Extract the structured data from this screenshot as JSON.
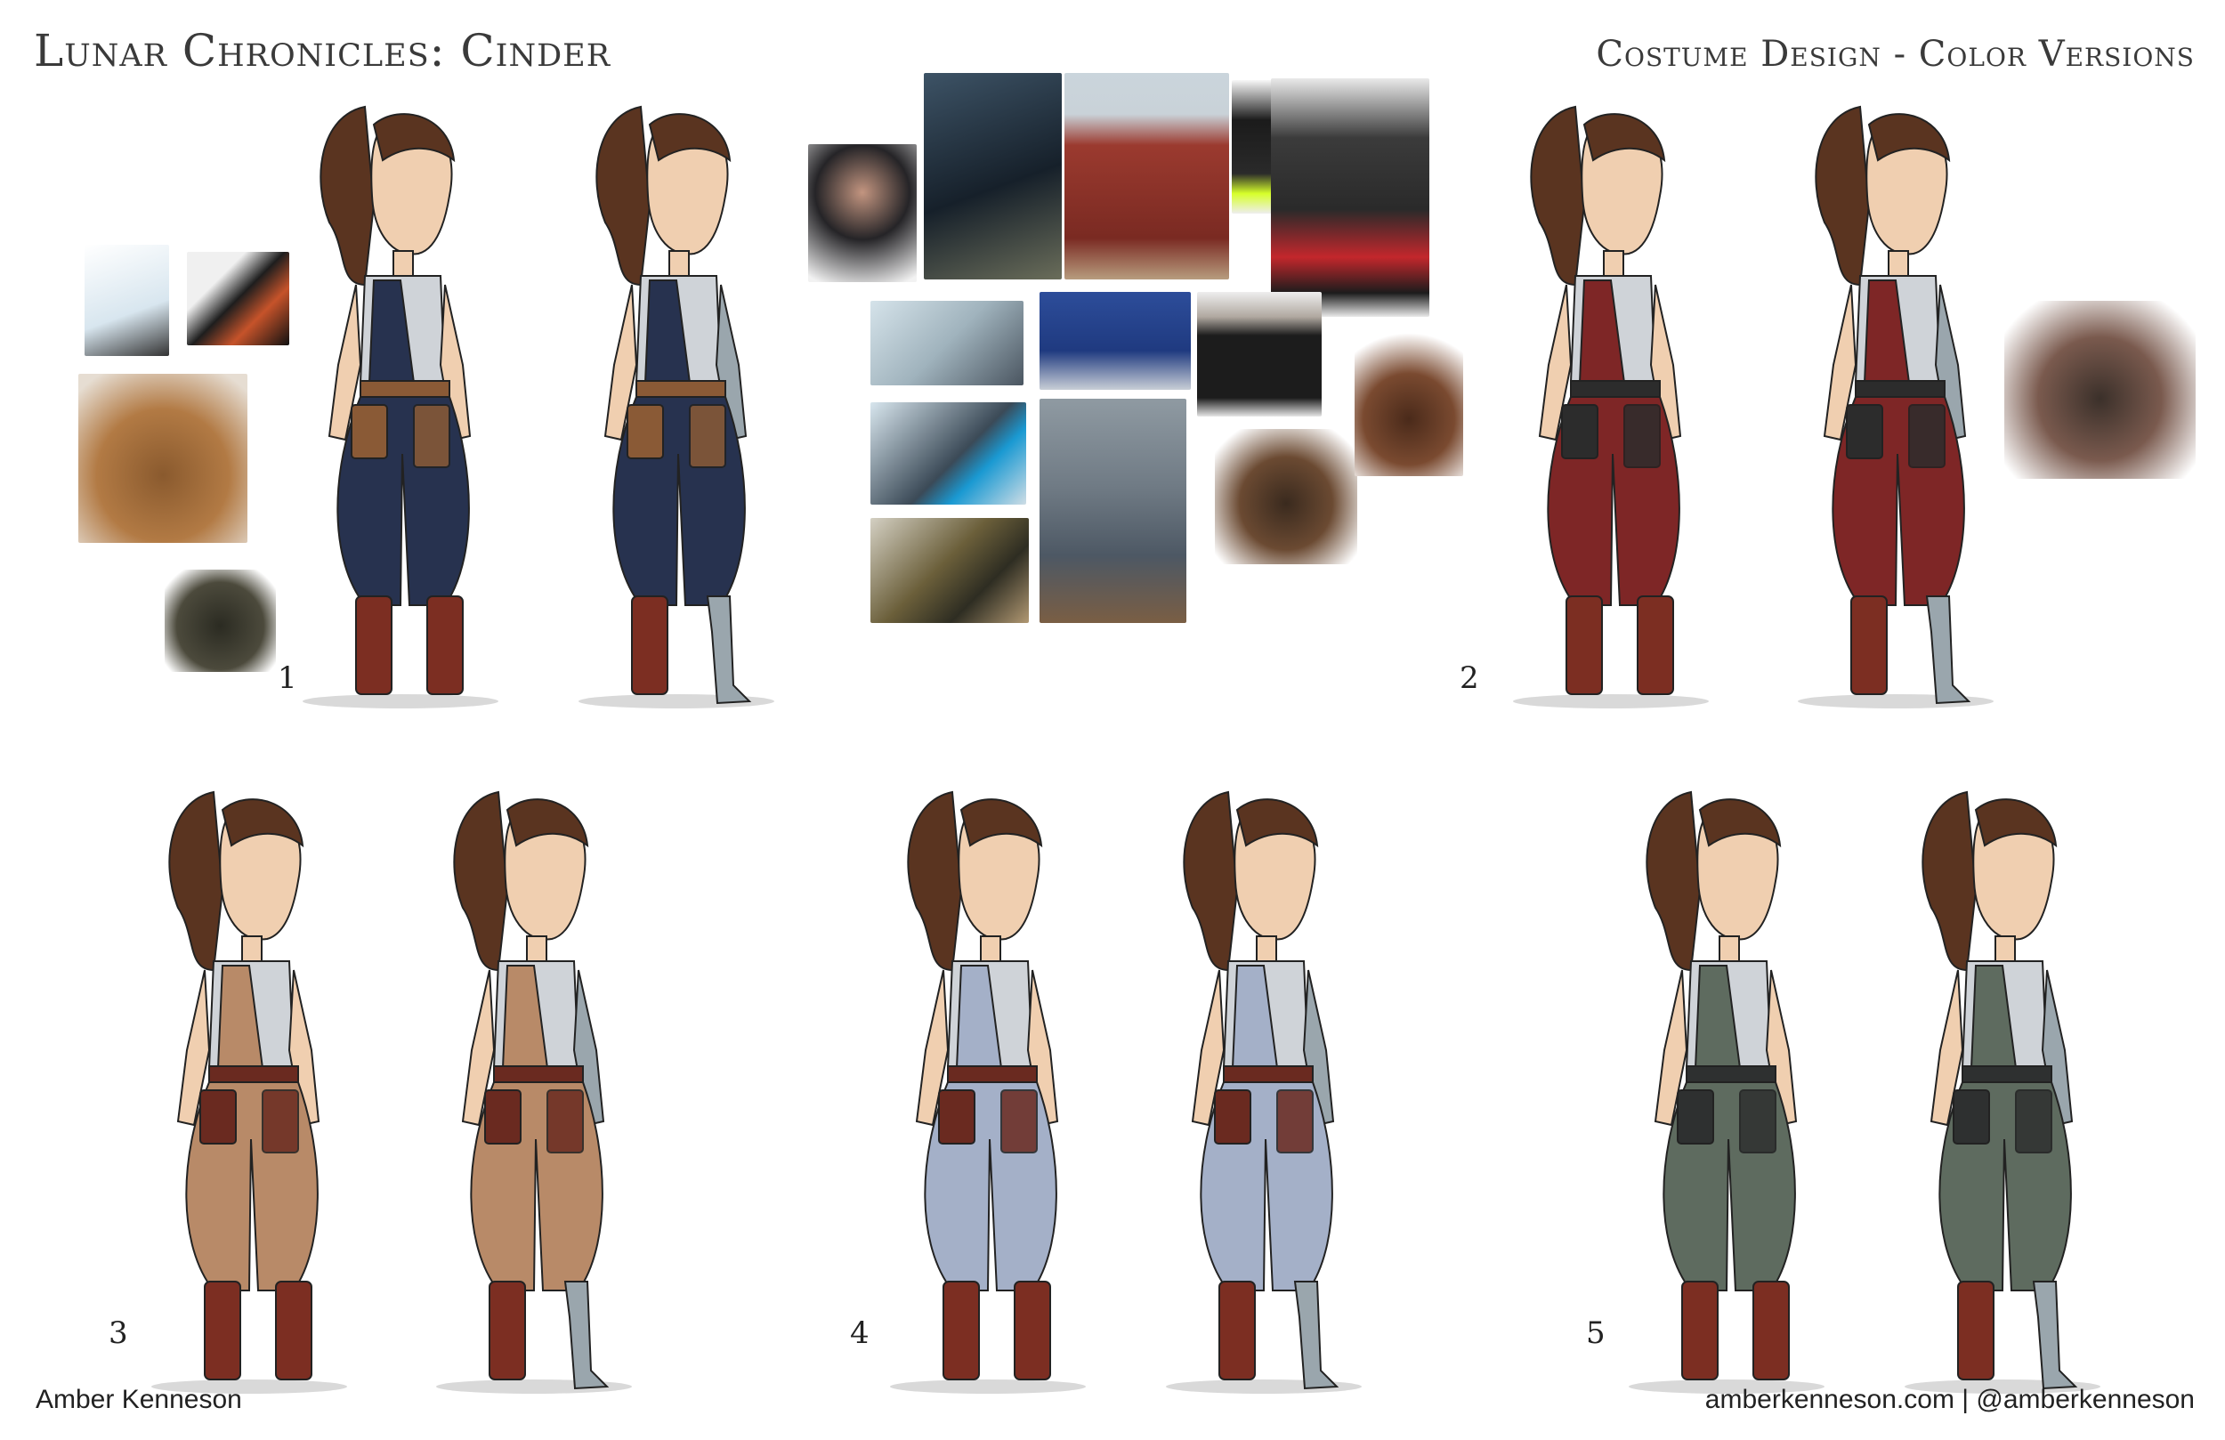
{
  "header": {
    "title_left": "Lunar Chronicles: Cinder",
    "title_right": "Costume Design - Color Versions"
  },
  "footer": {
    "artist": "Amber Kenneson",
    "website": "amberkenneson.com | @amberkenneson"
  },
  "versions": [
    {
      "number": "1",
      "overall_color": "#27324f",
      "belt_color": "#8a5a36"
    },
    {
      "number": "2",
      "overall_color": "#7e2626",
      "belt_color": "#2c2c2c"
    },
    {
      "number": "3",
      "overall_color": "#b88a68",
      "belt_color": "#6a2a20"
    },
    {
      "number": "4",
      "overall_color": "#a4b0c8",
      "belt_color": "#6a2a20"
    },
    {
      "number": "5",
      "overall_color": "#5e6b5f",
      "belt_color": "#2e3030"
    }
  ],
  "colors": {
    "skin": "#f0cfb0",
    "hair": "#5a3420",
    "top": "#cfd3d8",
    "boots": "#7c2e22",
    "prosthetic": "#9aa6ad"
  }
}
